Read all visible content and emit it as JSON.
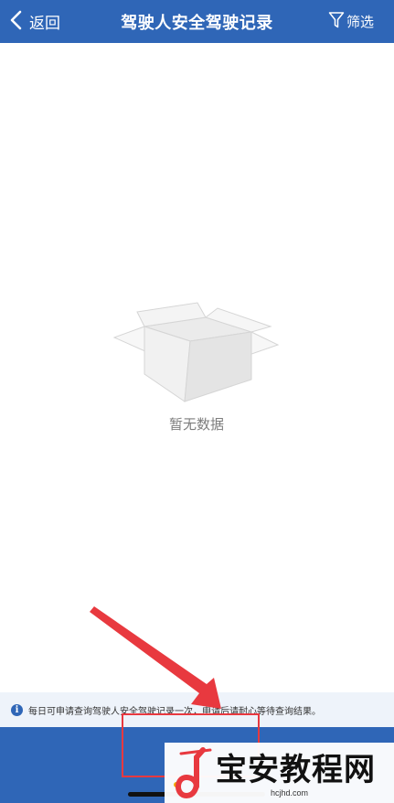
{
  "header": {
    "back_label": "返回",
    "title": "驾驶人安全驾驶记录",
    "filter_label": "筛选"
  },
  "empty_state": {
    "text": "暂无数据"
  },
  "notice": {
    "text": "每日可申请查询驾驶人安全驾驶记录一次，申请后请耐心等待查询结果。"
  },
  "watermark": {
    "brand": "宝安教程网",
    "url": "hcjhd.com"
  },
  "colors": {
    "primary": "#2f66b7",
    "annotation": "#e8393f",
    "notice_bg": "#eef3fa"
  }
}
